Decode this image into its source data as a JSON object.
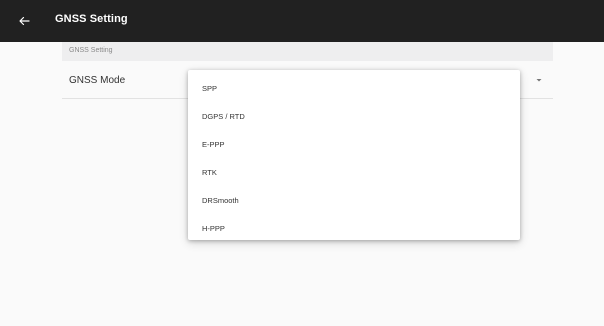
{
  "appbar": {
    "title": "GNSS Setting",
    "back_icon": "arrow-back-icon"
  },
  "section": {
    "header": "GNSS Setting"
  },
  "setting": {
    "label": "GNSS Mode",
    "dropdown_icon": "dropdown-arrow-icon"
  },
  "menu": {
    "options": [
      "SPP",
      "DGPS / RTD",
      "E-PPP",
      "RTK",
      "DRSmooth",
      "H-PPP"
    ]
  },
  "colors": {
    "appbar_bg": "#212121",
    "section_bg": "#eeeeef",
    "page_bg": "#fafafa",
    "menu_bg": "#ffffff"
  }
}
